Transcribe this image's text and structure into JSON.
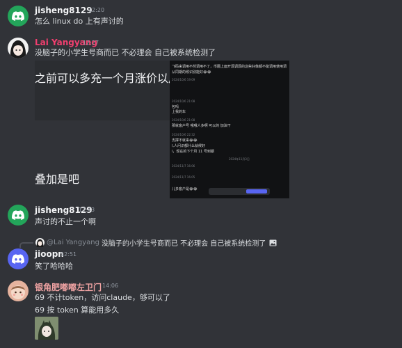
{
  "messages": {
    "m1": {
      "author": "jisheng8129",
      "author_color": "#f2f3f5",
      "time": "12:20",
      "text": "怎么 linux  do 上有声讨的"
    },
    "m2": {
      "author": "Lai Yangyang",
      "author_color": "#f23f6f",
      "time": "12:27",
      "text": "没脑子的小学生号商而已 不必理会 自己被系统检测了",
      "image_text": "之前可以多充一个月涨价以后ノ",
      "overlay_text": "叠加是吧",
      "screenshot_lines": [
        "飞码来调用不然调用不了，币圈上面开源调源的这些好像都不能调用使用调",
        "从同期的候识别能好😂😂",
        "2024/10/6 19:09",
        "2024/10/6 21:08",
        "包吗",
        "上我的车",
        "2024/10/6 21:08",
        "那就客户号 哦哦人多啊  可以的 加油干",
        "2024/10/6 22:32",
        "支撑不就来😂😂",
        "l,人问识都什么就候好",
        "l，现在的下个月 11 号到期",
        "2024年11月3日",
        "2024/11/7 16:06",
        "2024/11/7 16:05",
        "儿多客户是😂😂"
      ]
    },
    "m3": {
      "author": "jisheng8129",
      "author_color": "#f2f3f5",
      "time": "12:43",
      "text": "声讨的不止一个啊"
    },
    "reply": {
      "mention": "@Lai Yangyang",
      "text": "没脑子的小学生号商而已 不必理会 自己被系统检测了"
    },
    "m4": {
      "author": "jioopn",
      "author_color": "#f2f3f5",
      "time": "12:51",
      "text": "笑了哈哈哈"
    },
    "m5": {
      "author": "银角肥嘟嘟左卫门",
      "author_color": "#f0a3a3",
      "time": "14:06",
      "line1": "69 不计token，访问claude，够可以了",
      "line2": "69 按 token 算能用多久"
    }
  },
  "icons": [
    "discord-logo-icon",
    "image-icon"
  ],
  "colors": {
    "background": "#313338",
    "discord_green": "#23a55a",
    "discord_blurple": "#5865f2",
    "timestamp": "#949ba4"
  }
}
